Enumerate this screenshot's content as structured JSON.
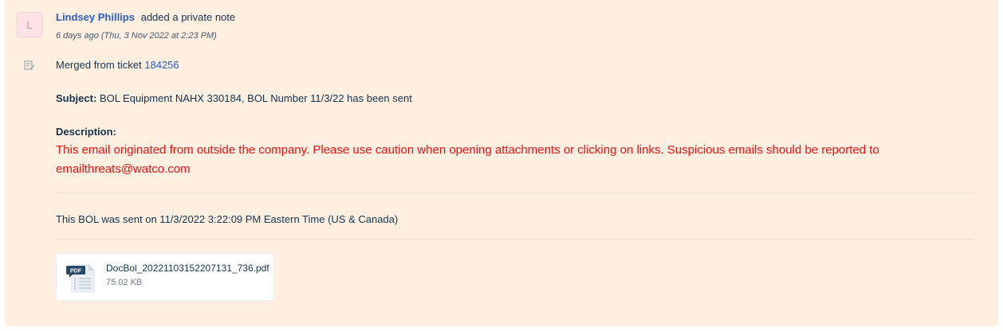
{
  "avatar": {
    "initial": "L"
  },
  "note": {
    "author": "Lindsey Phillips",
    "action": "added a private note",
    "timestamp": "6 days ago (Thu, 3 Nov 2022 at 2:23 PM)",
    "merged_prefix": "Merged from ticket ",
    "merged_ticket": "184256",
    "subject_label": "Subject:",
    "subject_value": " BOL Equipment NAHX 330184, BOL Number 11/3/22 has been sent",
    "description_label": "Description:",
    "warning_text": "This email originated from outside the company. Please use caution when opening attachments or clicking on links. Suspicious emails should be reported to emailthreats@watco.com",
    "bol_sent_text": "This BOL was sent on 11/3/2022 3:22:09 PM Eastern Time (US & Canada)"
  },
  "attachment": {
    "file_type_label": "PDF",
    "file_name": "DocBol_20221103152207131_736.pdf",
    "file_size": "75.02 KB"
  },
  "colors": {
    "card_background": "#feefe1",
    "link": "#2c5cc5",
    "warning": "#e81212"
  },
  "icons": {
    "note_type": "private-note-icon",
    "attachment": "pdf-file-icon"
  }
}
